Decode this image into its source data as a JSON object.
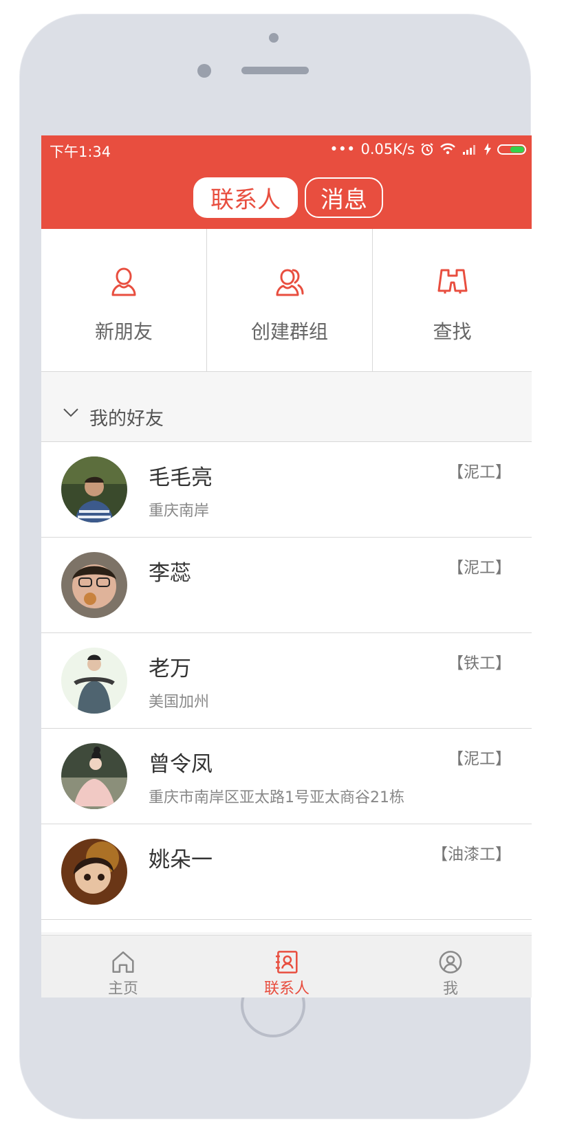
{
  "status_bar": {
    "time": "下午1:34",
    "speed": "0.05K/s"
  },
  "header": {
    "tabs": [
      {
        "label": "联系人",
        "active": true
      },
      {
        "label": "消息",
        "active": false
      }
    ]
  },
  "actions": [
    {
      "label": "新朋友",
      "icon": "person-icon"
    },
    {
      "label": "创建群组",
      "icon": "group-icon"
    },
    {
      "label": "查找",
      "icon": "binoculars-icon"
    }
  ],
  "group": {
    "title": "我的好友"
  },
  "contacts": [
    {
      "name": "毛毛亮",
      "location": "重庆南岸",
      "trade": "【泥工】"
    },
    {
      "name": "李蕊",
      "location": "",
      "trade": "【泥工】"
    },
    {
      "name": "老万",
      "location": "美国加州",
      "trade": "【铁工】"
    },
    {
      "name": "曾令凤",
      "location": "重庆市南岸区亚太路1号亚太商谷21栋",
      "trade": "【泥工】"
    },
    {
      "name": "姚朵一",
      "location": "",
      "trade": "【油漆工】"
    }
  ],
  "tabbar": [
    {
      "label": "主页",
      "icon": "home-icon",
      "active": false
    },
    {
      "label": "联系人",
      "icon": "contacts-book-icon",
      "active": true
    },
    {
      "label": "我",
      "icon": "profile-icon",
      "active": false
    }
  ],
  "colors": {
    "accent": "#e84e3f",
    "battery": "#35d14b"
  }
}
